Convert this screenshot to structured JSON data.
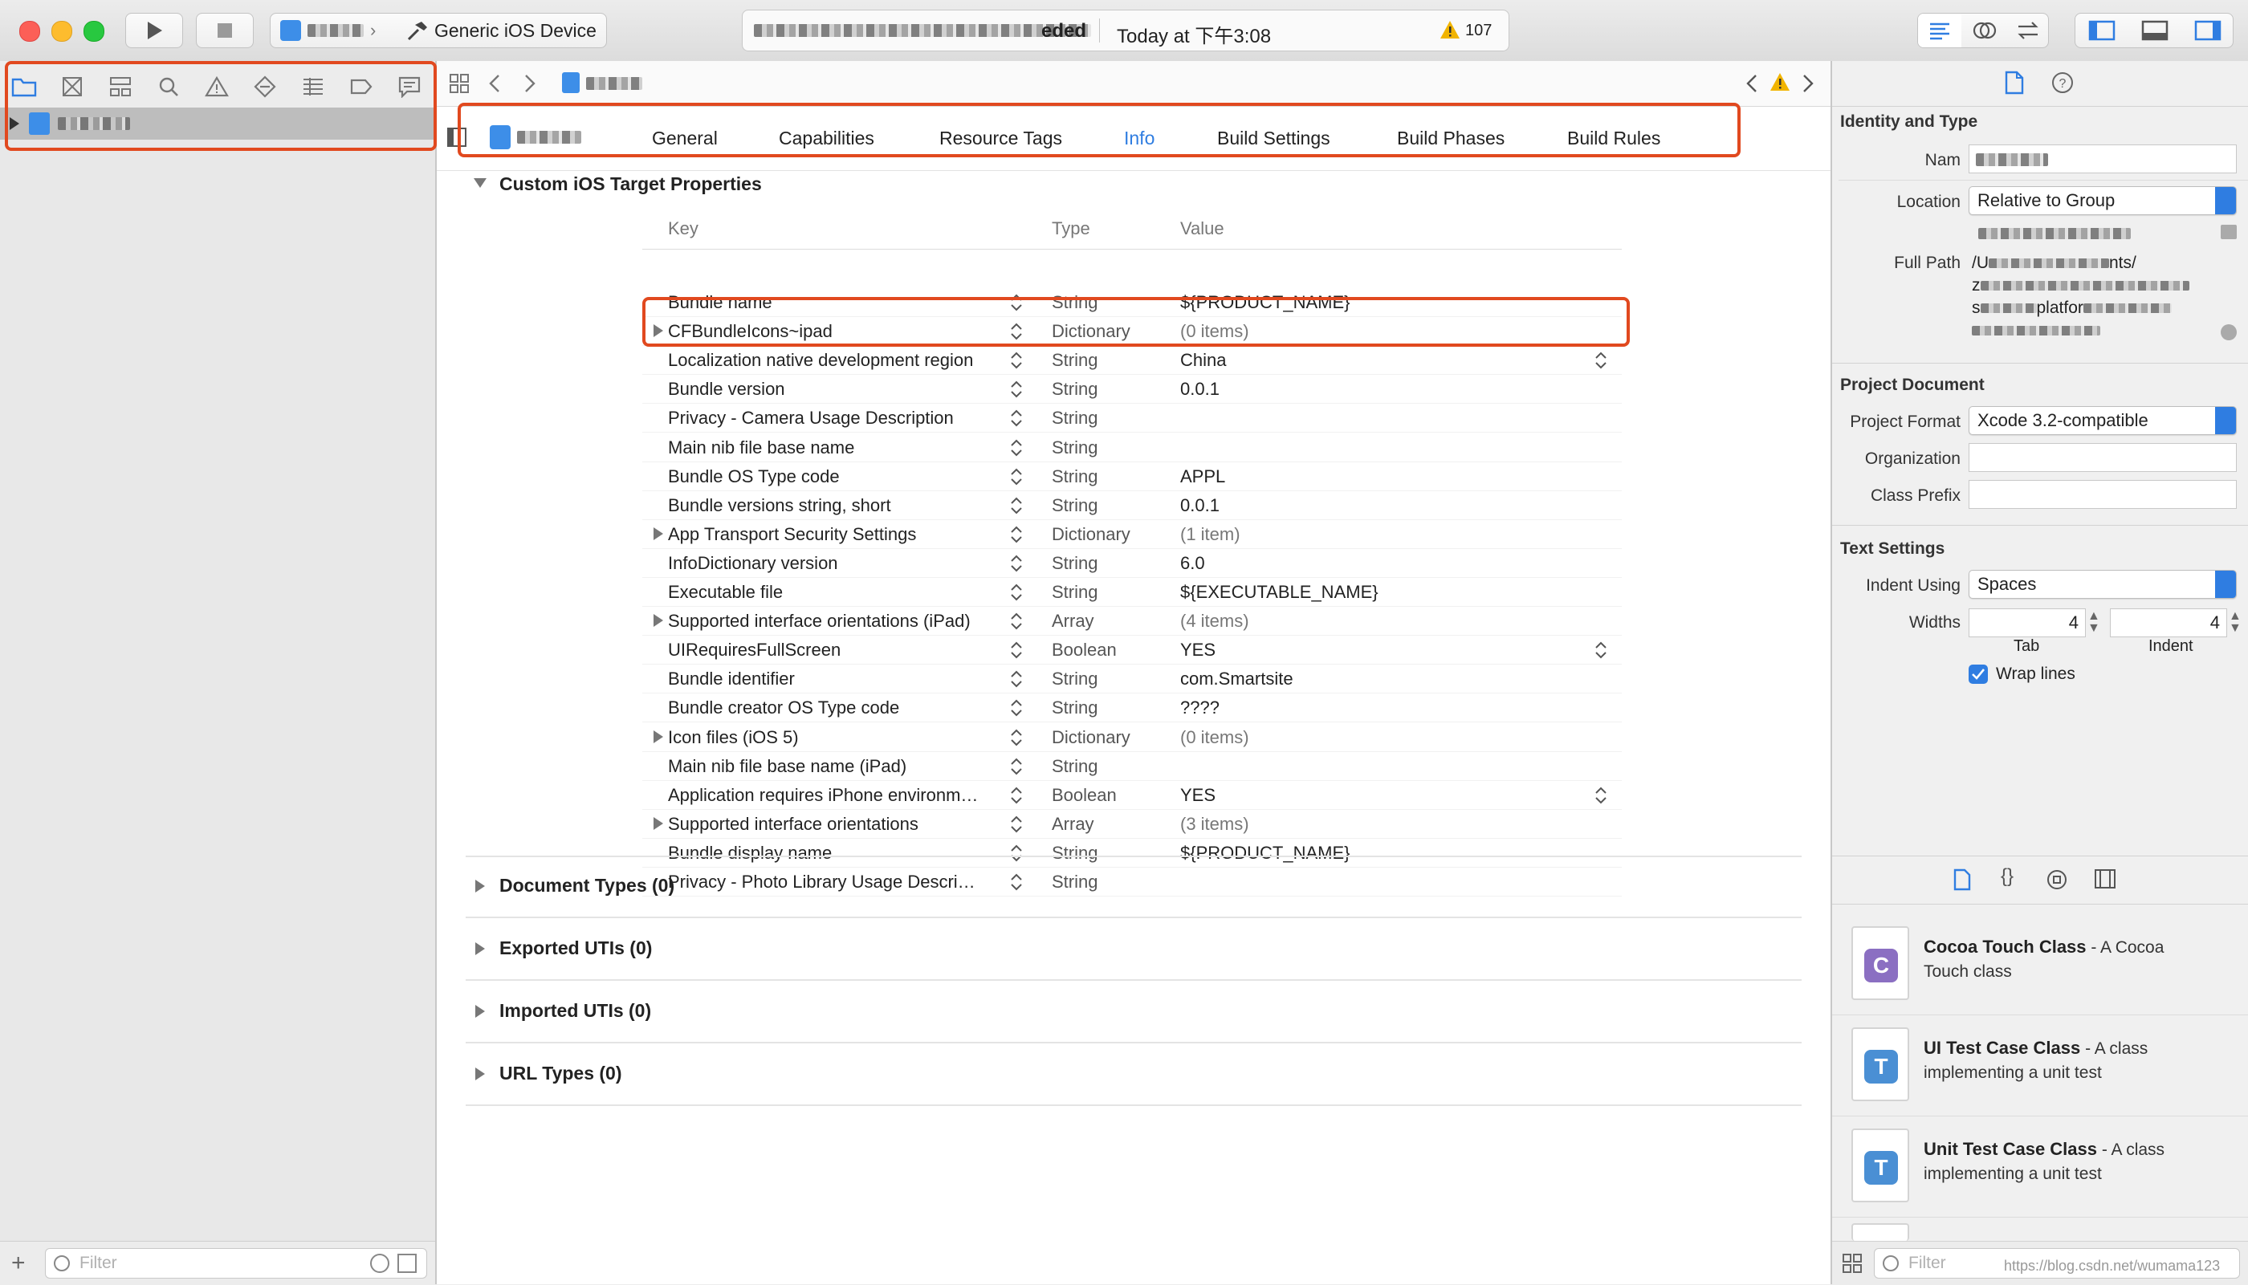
{
  "toolbar": {
    "scheme_device": "Generic iOS Device",
    "status_suffix": "eded",
    "status_time": "Today at 下午3:08",
    "warning_count": "107"
  },
  "editor": {
    "tabs": [
      "General",
      "Capabilities",
      "Resource Tags",
      "Info",
      "Build Settings",
      "Build Phases",
      "Build Rules"
    ],
    "active_tab": "Info",
    "section_title": "Custom iOS Target Properties",
    "columns": {
      "key": "Key",
      "type": "Type",
      "value": "Value"
    },
    "rows": [
      {
        "key": "Bundle name",
        "type": "String",
        "value": "${PRODUCT_NAME}"
      },
      {
        "key": "CFBundleIcons~ipad",
        "type": "Dictionary",
        "value": "(0 items)"
      },
      {
        "key": "Localization native development region",
        "type": "String",
        "value": "China"
      },
      {
        "key": "Bundle version",
        "type": "String",
        "value": "0.0.1"
      },
      {
        "key": "Privacy - Camera Usage Description",
        "type": "String",
        "value": ""
      },
      {
        "key": "Main nib file base name",
        "type": "String",
        "value": ""
      },
      {
        "key": "Bundle OS Type code",
        "type": "String",
        "value": "APPL"
      },
      {
        "key": "Bundle versions string, short",
        "type": "String",
        "value": "0.0.1"
      },
      {
        "key": "App Transport Security Settings",
        "type": "Dictionary",
        "value": "(1 item)"
      },
      {
        "key": "InfoDictionary version",
        "type": "String",
        "value": "6.0"
      },
      {
        "key": "Executable file",
        "type": "String",
        "value": "${EXECUTABLE_NAME}"
      },
      {
        "key": "Supported interface orientations (iPad)",
        "type": "Array",
        "value": "(4 items)"
      },
      {
        "key": "UIRequiresFullScreen",
        "type": "Boolean",
        "value": "YES"
      },
      {
        "key": "Bundle identifier",
        "type": "String",
        "value": "com.Smartsite"
      },
      {
        "key": "Bundle creator OS Type code",
        "type": "String",
        "value": "????"
      },
      {
        "key": "Icon files (iOS 5)",
        "type": "Dictionary",
        "value": "(0 items)"
      },
      {
        "key": "Main nib file base name (iPad)",
        "type": "String",
        "value": ""
      },
      {
        "key": "Application requires iPhone environm…",
        "type": "Boolean",
        "value": "YES"
      },
      {
        "key": "Supported interface orientations",
        "type": "Array",
        "value": "(3 items)"
      },
      {
        "key": "Bundle display name",
        "type": "String",
        "value": "${PRODUCT_NAME}"
      },
      {
        "key": "Privacy - Photo Library Usage Descri…",
        "type": "String",
        "value": ""
      }
    ],
    "collapsed_sections": [
      "Document Types (0)",
      "Exported UTIs (0)",
      "Imported UTIs (0)",
      "URL Types (0)"
    ]
  },
  "navigator": {
    "filter_placeholder": "Filter"
  },
  "inspector": {
    "identity_title": "Identity and Type",
    "name_label": "Nam",
    "location_label": "Location",
    "location_value": "Relative to Group",
    "full_path_label": "Full Path",
    "full_path_line1_prefix": "/U",
    "full_path_line1_suffix": "nts/",
    "full_path_line2_prefix": "z",
    "full_path_line3_prefix": "s",
    "full_path_line3_mid": "platfor",
    "project_doc_title": "Project Document",
    "project_format_label": "Project Format",
    "project_format_value": "Xcode 3.2-compatible",
    "organization_label": "Organization",
    "class_prefix_label": "Class Prefix",
    "text_settings_title": "Text Settings",
    "indent_using_label": "Indent Using",
    "indent_using_value": "Spaces",
    "widths_label": "Widths",
    "tab_width": "4",
    "indent_width": "4",
    "tab_label": "Tab",
    "indent_label": "Indent",
    "wrap_lines_label": "Wrap lines",
    "filter_placeholder": "Filter",
    "templates": [
      {
        "title": "Cocoa Touch Class",
        "desc1": " - A Cocoa",
        "desc2": "Touch class",
        "letter": "C",
        "color": "#8b6fc2"
      },
      {
        "title": "UI Test Case Class",
        "desc1": " - A class",
        "desc2": "implementing a unit test",
        "letter": "T",
        "color": "#4a8fd4"
      },
      {
        "title": "Unit Test Case Class",
        "desc1": " - A class",
        "desc2": "implementing a unit test",
        "letter": "T",
        "color": "#4a8fd4"
      }
    ],
    "watermark": "https://blog.csdn.net/wumama123"
  }
}
